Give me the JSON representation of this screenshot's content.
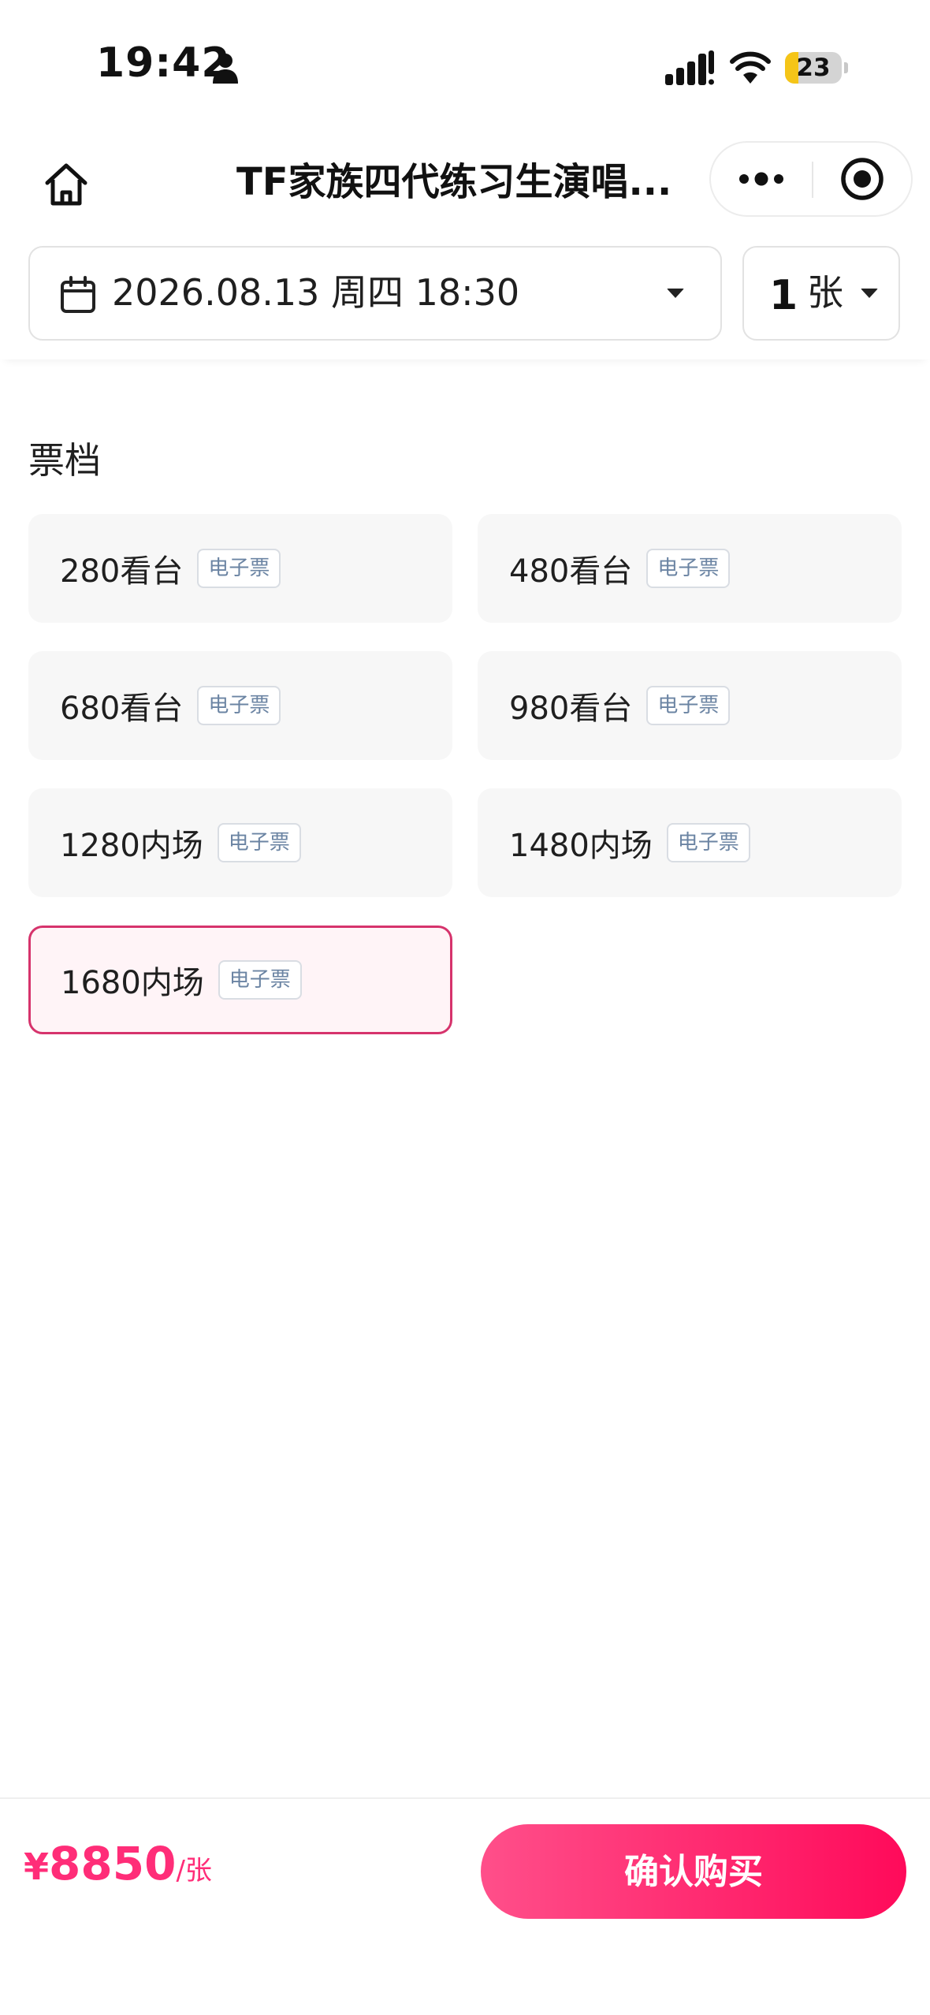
{
  "status_bar": {
    "time": "19:42",
    "battery_level": "23",
    "battery_fraction": 0.23,
    "icons": [
      "person-icon",
      "signal-icon",
      "wifi-icon",
      "battery-icon"
    ]
  },
  "nav": {
    "title": "TF家族四代练习生演唱...",
    "icons": [
      "home-icon",
      "more-icon",
      "close-target-icon"
    ]
  },
  "selectors": {
    "date": "2026.08.13 周四 18:30",
    "quantity": "1",
    "quantity_unit": "张",
    "icons": [
      "calendar-icon",
      "chevron-down-icon"
    ]
  },
  "tiers": {
    "section_title": "票档",
    "items": [
      {
        "label": "280看台",
        "tag": "电子票",
        "selected": false
      },
      {
        "label": "480看台",
        "tag": "电子票",
        "selected": false
      },
      {
        "label": "680看台",
        "tag": "电子票",
        "selected": false
      },
      {
        "label": "980看台",
        "tag": "电子票",
        "selected": false
      },
      {
        "label": "1280内场",
        "tag": "电子票",
        "selected": false
      },
      {
        "label": "1480内场",
        "tag": "电子票",
        "selected": false
      },
      {
        "label": "1680内场",
        "tag": "电子票",
        "selected": true
      }
    ]
  },
  "footer": {
    "currency": "¥",
    "price": "8850",
    "unit": "/张",
    "buy_label": "确认购买"
  },
  "colors": {
    "accent": "#ff2d78",
    "selected_border": "#d6336c",
    "selected_bg": "#fff4f7",
    "tier_bg": "#f7f7f7",
    "tag_text": "#6b84a3",
    "battery": "#f5c518"
  }
}
